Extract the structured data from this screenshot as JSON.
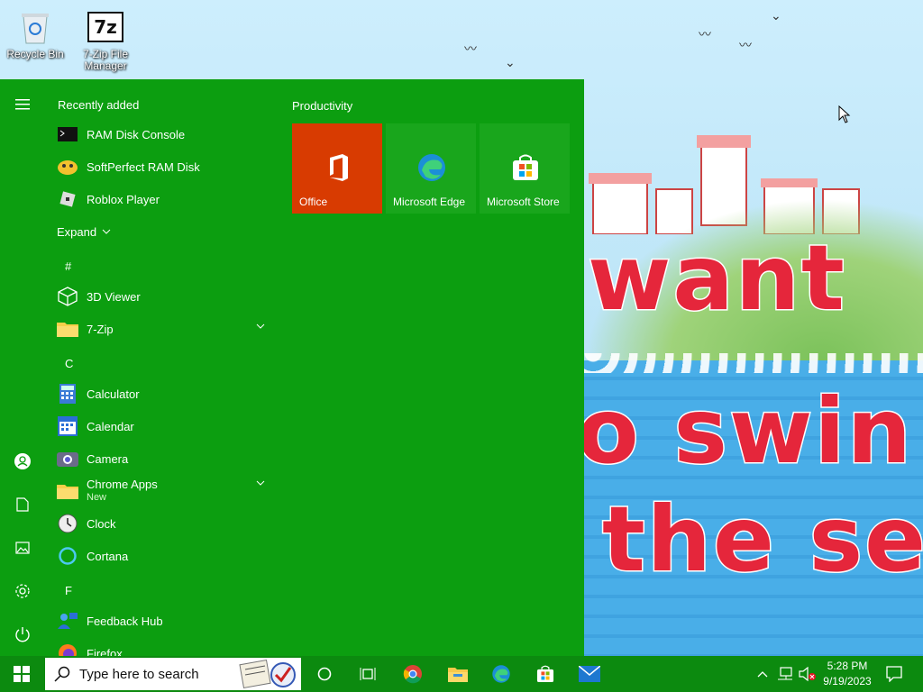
{
  "desktop": {
    "icons": [
      {
        "label": "Recycle Bin",
        "icon": "recycle-bin-icon"
      },
      {
        "label": "7-Zip File Manager",
        "icon": "7zip-icon",
        "glyph": "7z"
      }
    ],
    "wallpaper_text": [
      "want",
      "o swin",
      "the se"
    ]
  },
  "start_menu": {
    "bg_color": "#0c9e10",
    "recently_added_header": "Recently added",
    "recent_apps": [
      {
        "label": "RAM Disk Console",
        "icon": "console-icon"
      },
      {
        "label": "SoftPerfect RAM Disk",
        "icon": "ram-disk-icon"
      },
      {
        "label": "Roblox Player",
        "icon": "roblox-icon"
      }
    ],
    "expand_label": "Expand",
    "groups": [
      {
        "letter": "#",
        "apps": [
          {
            "label": "3D Viewer",
            "icon": "cube-icon"
          },
          {
            "label": "7-Zip",
            "icon": "folder-icon",
            "expandable": true
          }
        ]
      },
      {
        "letter": "C",
        "apps": [
          {
            "label": "Calculator",
            "icon": "calculator-icon"
          },
          {
            "label": "Calendar",
            "icon": "calendar-icon"
          },
          {
            "label": "Camera",
            "icon": "camera-icon"
          },
          {
            "label": "Chrome Apps",
            "sub": "New",
            "icon": "folder-icon",
            "expandable": true
          },
          {
            "label": "Clock",
            "icon": "clock-icon"
          },
          {
            "label": "Cortana",
            "icon": "cortana-icon"
          }
        ]
      },
      {
        "letter": "F",
        "apps": [
          {
            "label": "Feedback Hub",
            "icon": "feedback-icon"
          },
          {
            "label": "Firefox",
            "icon": "firefox-icon"
          }
        ]
      }
    ],
    "tiles_title": "Productivity",
    "tiles": [
      {
        "label": "Office",
        "color": "#d83b01",
        "icon": "office-icon"
      },
      {
        "label": "Microsoft Edge",
        "color": "#19a61c",
        "icon": "edge-icon"
      },
      {
        "label": "Microsoft Store",
        "color": "#19a61c",
        "icon": "store-icon"
      }
    ]
  },
  "taskbar": {
    "search_placeholder": "Type here to search",
    "pinned": [
      "chrome-icon",
      "file-explorer-icon",
      "edge-icon",
      "store-icon",
      "mail-icon"
    ],
    "clock": {
      "time": "5:28 PM",
      "date": "9/19/2023"
    }
  }
}
